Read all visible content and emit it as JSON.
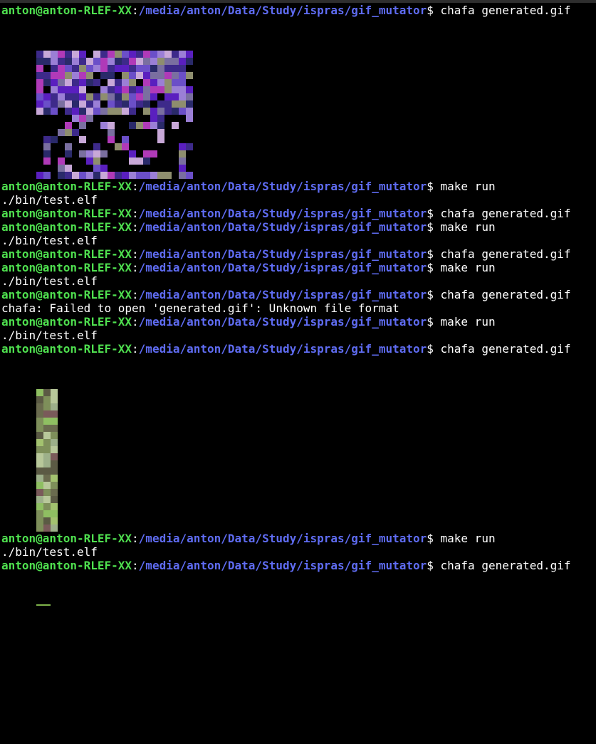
{
  "terminal": {
    "prompt": {
      "user": "anton@anton-RLEF-XX",
      "colon": ":",
      "path": "/media/anton/Data/Study/ispras/gif_mutator",
      "sign": "$ "
    },
    "commands": {
      "chafa": "chafa generated.gif",
      "make": "make run"
    },
    "outputs": {
      "elf": "./bin/test.elf",
      "error": "chafa: Failed to open 'generated.gif': Unknown file format"
    }
  },
  "images": {
    "first": {
      "description_colors": [
        "#5a1fbf",
        "#9b7fd6",
        "#b03ab8",
        "#7a6fa0",
        "#3d2a8a",
        "#c8a8d8",
        "#6b4fc8",
        "#8e8e6e",
        "#000000",
        "#2a2a6a"
      ]
    },
    "second": {
      "description_colors": [
        "#7e8f5a",
        "#a3c26f",
        "#6a6b4e",
        "#9db08a",
        "#5b5a44",
        "#8fbf62",
        "#7a5a5a",
        "#b8c89a"
      ]
    }
  }
}
